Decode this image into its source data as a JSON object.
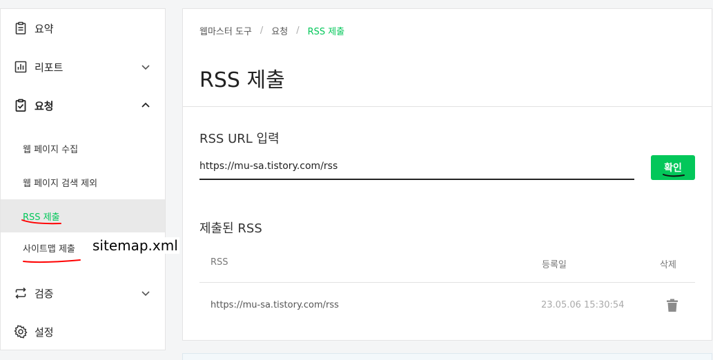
{
  "sidebar": {
    "summary": "요약",
    "report": "리포트",
    "request": "요청",
    "sub_items": [
      "웹 페이지 수집",
      "웹 페이지 검색 제외",
      "RSS 제출",
      "사이트맵 제출"
    ],
    "verify": "검증",
    "settings": "설정"
  },
  "annotation": {
    "text": "sitemap.xml"
  },
  "breadcrumb": {
    "home": "웹마스터 도구",
    "section": "요청",
    "current": "RSS 제출"
  },
  "page_title": "RSS 제출",
  "form": {
    "label": "RSS URL 입력",
    "value": "https://mu-sa.tistory.com/rss",
    "button": "확인"
  },
  "submitted": {
    "title": "제출된 RSS",
    "columns": [
      "RSS",
      "등록일",
      "삭제"
    ],
    "rows": [
      {
        "url": "https://mu-sa.tistory.com/rss",
        "date": "23.05.06 15:30:54"
      }
    ]
  },
  "colors": {
    "accent": "#03c75a",
    "ink": "#ff0000"
  },
  "icons": [
    "clipboard-icon",
    "bar-chart-icon",
    "clipboard-check-icon",
    "repeat-icon",
    "gear-icon",
    "trash-icon",
    "chevron-down-icon",
    "chevron-up-icon"
  ]
}
